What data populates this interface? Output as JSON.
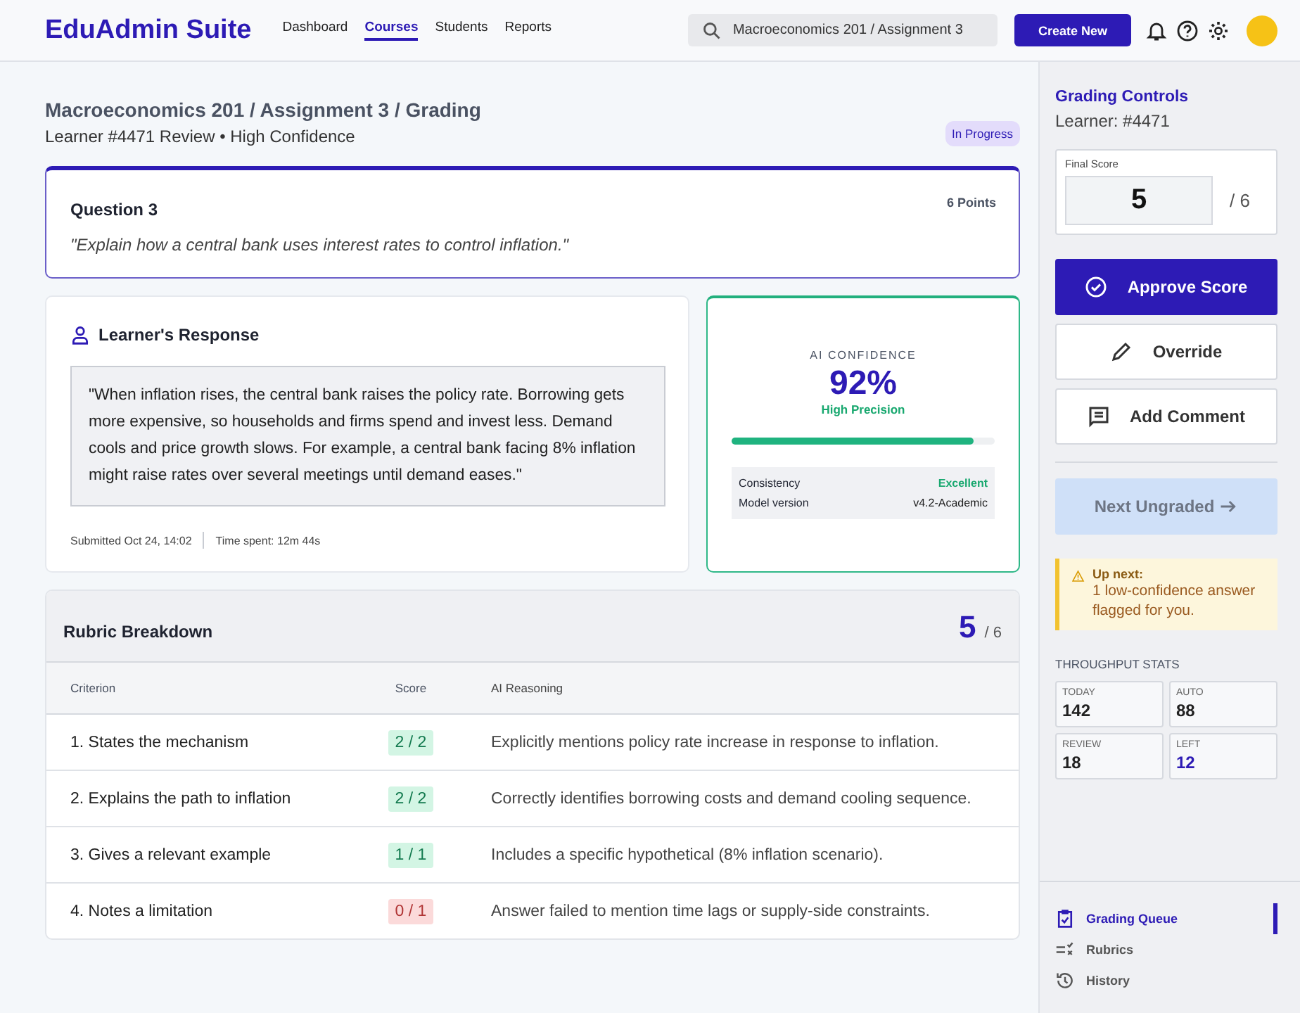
{
  "header": {
    "logo": "EduAdmin Suite",
    "nav": [
      {
        "label": "Dashboard",
        "selected": false
      },
      {
        "label": "Courses",
        "selected": true
      },
      {
        "label": "Students",
        "selected": false
      },
      {
        "label": "Reports",
        "selected": false
      }
    ],
    "search": {
      "value": "Macroeconomics 201 / Assignment 3"
    },
    "create_button": "Create New"
  },
  "page": {
    "breadcrumb": "Macroeconomics 201 / Assignment 3 / Grading",
    "subtitle": "Learner #4471 Review • High Confidence",
    "status": "In Progress"
  },
  "question": {
    "title": "Question 3",
    "points": "6 Points",
    "prompt": "\"Explain how a central bank uses interest rates to control inflation.\""
  },
  "response": {
    "title": "Learner's Response",
    "text": "\"When inflation rises, the central bank raises the policy rate. Borrowing gets more expensive, so households and firms spend and invest less. Demand cools and price growth slows. For example, a central bank facing 8% inflation might raise rates over several meetings until demand eases.\"",
    "submitted": "Submitted Oct 24, 14:02",
    "time_spent": "Time spent: 12m 44s"
  },
  "confidence": {
    "label": "AI CONFIDENCE",
    "value": "92%",
    "caption": "High Precision",
    "level": 0.92,
    "details": [
      {
        "label": "Consistency",
        "value": "Excellent",
        "kind": "good"
      },
      {
        "label": "Model version",
        "value": "v4.2-Academic",
        "kind": "plain"
      }
    ]
  },
  "rubric": {
    "title": "Rubric Breakdown",
    "score": "5",
    "total": "/ 6",
    "columns": [
      "Criterion",
      "Score",
      "AI Reasoning"
    ],
    "rows": [
      {
        "criterion": "1. States the mechanism",
        "score": "2 / 2",
        "kind": "full",
        "reasoning": "Explicitly mentions policy rate increase in response to inflation."
      },
      {
        "criterion": "2. Explains the path to inflation",
        "score": "2 / 2",
        "kind": "full",
        "reasoning": "Correctly identifies borrowing costs and demand cooling sequence."
      },
      {
        "criterion": "3. Gives a relevant example",
        "score": "1 / 1",
        "kind": "full",
        "reasoning": "Includes a specific hypothetical (8% inflation scenario)."
      },
      {
        "criterion": "4. Notes a limitation",
        "score": "0 / 1",
        "kind": "none",
        "reasoning": "Answer failed to mention time lags or supply-side constraints."
      }
    ]
  },
  "sidebar": {
    "title": "Grading Controls",
    "learner": "Learner: #4471",
    "final_score": {
      "label": "Final Score",
      "value": "5",
      "total": "/ 6"
    },
    "buttons": [
      {
        "label": "Approve Score",
        "kind": "primary"
      },
      {
        "label": "Override",
        "kind": "pencil"
      },
      {
        "label": "Add Comment",
        "kind": "comment"
      }
    ],
    "next_button": {
      "label": "Next Ungraded",
      "disabled": true
    },
    "alert": {
      "title": "Up next:",
      "text": "1 low-confidence answer flagged for you."
    },
    "stats_title": "THROUGHPUT STATS",
    "stats": [
      {
        "label": "TODAY",
        "value": "142",
        "accent": false
      },
      {
        "label": "AUTO",
        "value": "88",
        "accent": false
      },
      {
        "label": "REVIEW",
        "value": "18",
        "accent": false
      },
      {
        "label": "LEFT",
        "value": "12",
        "accent": true
      }
    ],
    "nav": [
      {
        "label": "Grading Queue",
        "kind": "queue",
        "selected": true
      },
      {
        "label": "Rubrics",
        "kind": "rubrics",
        "selected": false
      },
      {
        "label": "History",
        "kind": "history",
        "selected": false
      }
    ]
  }
}
